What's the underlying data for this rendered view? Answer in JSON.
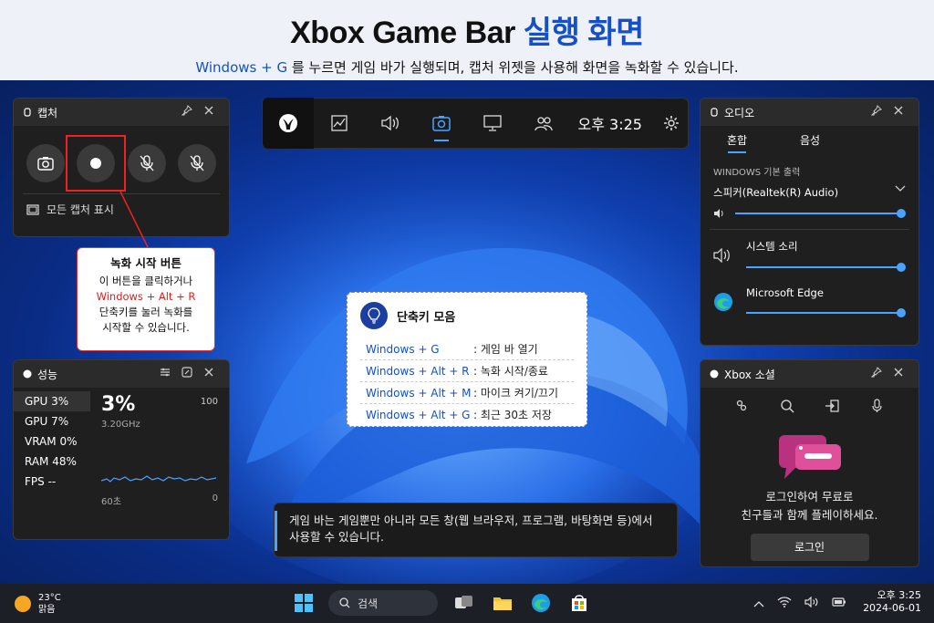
{
  "header": {
    "title_main": "Xbox Game Bar",
    "title_accent": "실행 화면",
    "subtitle_accent": "Windows + G",
    "subtitle_rest": " 를 누르면 게임 바가 실행되며, 캡처 위젯을 사용해 화면을 녹화할 수 있습니다."
  },
  "capture": {
    "title": "캡처",
    "show_all": "모든 캡처 표시"
  },
  "callout": {
    "title": "녹화 시작 버튼",
    "line1": "이 버튼을 클릭하거나",
    "line2": "Windows + Alt + R",
    "line3": "단축키를 눌러 녹화를",
    "line4": "시작할 수 있습니다."
  },
  "topbar": {
    "time": "오후 3:25"
  },
  "performance": {
    "title": "성능",
    "items": [
      "GPU 3%",
      "GPU 7%",
      "VRAM  0%",
      "RAM 48%",
      "FPS --"
    ],
    "big_value": "3%",
    "frequency": "3.20GHz",
    "max": "100",
    "axis_left": "60초",
    "axis_right": "0"
  },
  "shortcuts": {
    "title": "단축키 모음",
    "rows": [
      {
        "key": "Windows + G",
        "desc": ": 게임 바 열기"
      },
      {
        "key": "Windows + Alt + R",
        "desc": ": 녹화 시작/종료"
      },
      {
        "key": "Windows + Alt + M",
        "desc": ": 마이크 켜기/끄기"
      },
      {
        "key": "Windows + Alt + G",
        "desc": ": 최근 30초 저장"
      }
    ]
  },
  "audio": {
    "title": "오디오",
    "tab_mix": "혼합",
    "tab_voice": "음성",
    "section": "WINDOWS 기본 출력",
    "device": "스피커(Realtek(R) Audio)",
    "app1": "시스템 소리",
    "app2": "Microsoft Edge",
    "master_level": 1.0,
    "app1_level": 1.0,
    "app2_level": 1.0
  },
  "social": {
    "title": "Xbox 소셜",
    "line1": "로그인하여 무료로",
    "line2": "친구들과 함께 플레이하세요.",
    "login": "로그인"
  },
  "info": {
    "line1": "게임 바는 게임뿐만 아니라 모든 창(웹 브라우저, 프로그램, 바탕화면 등)에서",
    "line2": "사용할 수 있습니다."
  },
  "taskbar": {
    "temp": "23°C",
    "weather": "맑음",
    "search": "검색",
    "time": "오후 3:25",
    "date": "2024-06-01"
  },
  "colors": {
    "accent": "#1550c8",
    "highlight": "#e21b1b",
    "slider": "#4aa3ff"
  }
}
